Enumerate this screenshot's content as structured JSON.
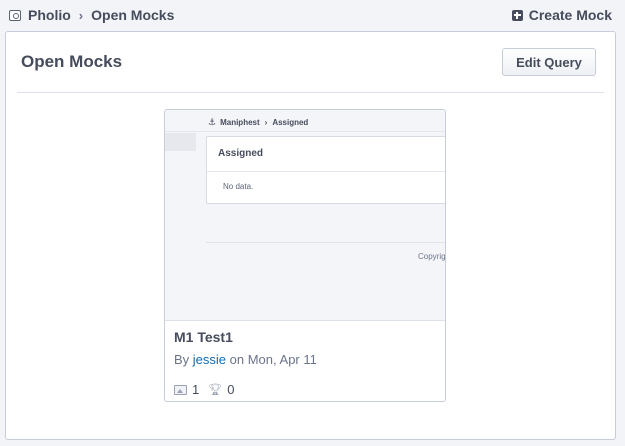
{
  "crumbs": {
    "app_icon": "camera-icon",
    "app_label": "Pholio",
    "separator": "›",
    "current_label": "Open Mocks"
  },
  "actions": {
    "create_icon": "plus-square-icon",
    "create_label": "Create Mock"
  },
  "box": {
    "title": "Open Mocks",
    "edit_query_label": "Edit Query"
  },
  "mock": {
    "thumbnail": {
      "crumb_icon": "anchor-icon",
      "crumb_app": "Maniphest",
      "crumb_sep": "›",
      "crumb_current": "Assigned",
      "panel_title": "Assigned",
      "panel_empty": "No data.",
      "footer_text": "Copyright"
    },
    "title": "M1 Test1",
    "by_label": "By ",
    "author": "jessie",
    "date_text": " on Mon, Apr 11",
    "image_count": "1",
    "token_count": "0"
  },
  "colors": {
    "link": "#136cb2",
    "text": "#464c5c",
    "background": "#f3f4f7"
  }
}
